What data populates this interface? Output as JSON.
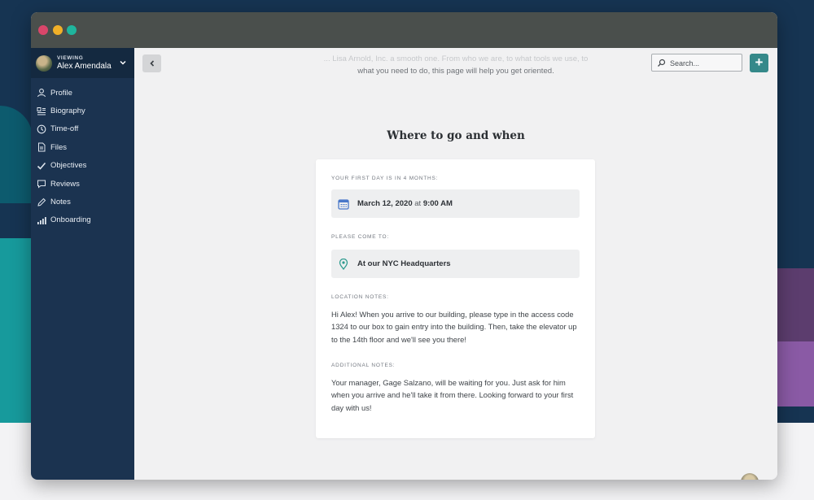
{
  "user": {
    "viewing_label": "VIEWING",
    "name": "Alex Amendala"
  },
  "sidebar": {
    "items": [
      {
        "label": "Profile",
        "icon": "person-icon"
      },
      {
        "label": "Biography",
        "icon": "biography-icon"
      },
      {
        "label": "Time-off",
        "icon": "clock-icon"
      },
      {
        "label": "Files",
        "icon": "file-icon"
      },
      {
        "label": "Objectives",
        "icon": "checkmark-icon"
      },
      {
        "label": "Reviews",
        "icon": "speech-bubble-icon"
      },
      {
        "label": "Notes",
        "icon": "pencil-icon"
      },
      {
        "label": "Onboarding",
        "icon": "bar-chart-icon"
      }
    ]
  },
  "header": {
    "intro_line1": "... Lisa Arnold, Inc. a smooth one. From who we are, to what tools we use, to",
    "intro_line2": "what you need to do, this page will help you get oriented.",
    "search_placeholder": "Search...",
    "add_label": "+"
  },
  "section": {
    "title": "Where to go and when"
  },
  "card": {
    "first_day_label": "YOUR FIRST DAY IS IN 4 MONTHS:",
    "date": "March 12, 2020",
    "date_at": "at",
    "time": "9:00 AM",
    "come_label": "PLEASE COME TO:",
    "location": "At our NYC Headquarters",
    "location_notes_label": "LOCATION NOTES:",
    "location_notes": "Hi Alex! When you arrive to our building, please type in the access code 1324 to our box to gain entry into the building. Then, take the elevator up to the 14th floor and we'll see you there!",
    "additional_notes_label": "ADDITIONAL NOTES:",
    "additional_notes": "Your manager, Gage Salzano, will be waiting for you. Just ask for him when you arrive and he'll take it from there. Looking forward to your first day with us!"
  },
  "colors": {
    "sidebar": "#1b3350",
    "accent": "#35898a",
    "calendar_icon": "#4a78c9",
    "location_icon": "#2e9b8f"
  }
}
